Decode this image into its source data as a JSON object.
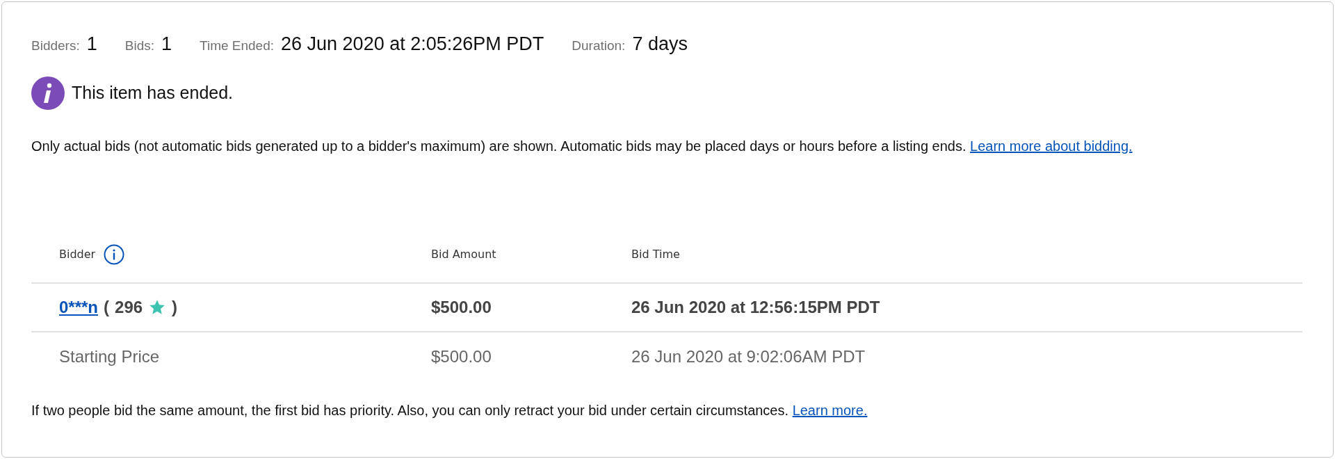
{
  "stats": [
    {
      "label": "Bidders:",
      "value": "1"
    },
    {
      "label": "Bids:",
      "value": "1"
    },
    {
      "label": "Time Ended:",
      "value": "26 Jun 2020 at 2:05:26PM PDT"
    },
    {
      "label": "Duration:",
      "value": "7 days"
    }
  ],
  "notice": "This item has ended.",
  "note": {
    "text": "Only actual bids (not automatic bids generated up to a bidder's maximum) are shown. Automatic bids may be placed days or hours before a listing ends.",
    "link": "Learn more about bidding."
  },
  "table": {
    "columns": [
      "Bidder",
      "Bid Amount",
      "Bid Time"
    ],
    "rows": [
      {
        "kind": "bid",
        "bidder": "0***n",
        "score_open": "(",
        "score": "296",
        "score_close": ")",
        "amount": "$500.00",
        "time": "26 Jun 2020 at 12:56:15PM PDT"
      },
      {
        "kind": "start",
        "bidder": "Starting Price",
        "amount": "$500.00",
        "time": "26 Jun 2020 at 9:02:06AM PDT"
      }
    ]
  },
  "footer": {
    "text": "If two people bid the same amount, the first bid has priority. Also, you can only retract your bid under certain circumstances.",
    "link": "Learn more."
  }
}
